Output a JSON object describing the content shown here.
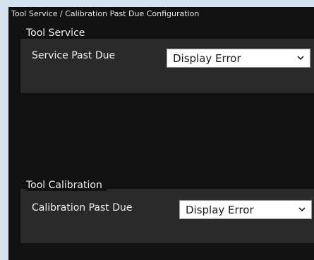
{
  "window": {
    "title": "Tool Service / Calibration Past Due Configuration"
  },
  "service": {
    "group_label": "Tool Service",
    "field_label": "Service Past Due",
    "selected": "Display Error"
  },
  "calibration": {
    "group_label": "Tool Calibration",
    "field_label": "Calibration Past Due",
    "selected": "Display Error"
  },
  "colors": {
    "page_background": "#d6e2ee",
    "panel_background": "#111111",
    "group_background": "#2a2a2a",
    "text": "#f0f0f0",
    "select_background": "#ffffff"
  },
  "icons": {
    "dropdown": "chevron-down-icon"
  }
}
